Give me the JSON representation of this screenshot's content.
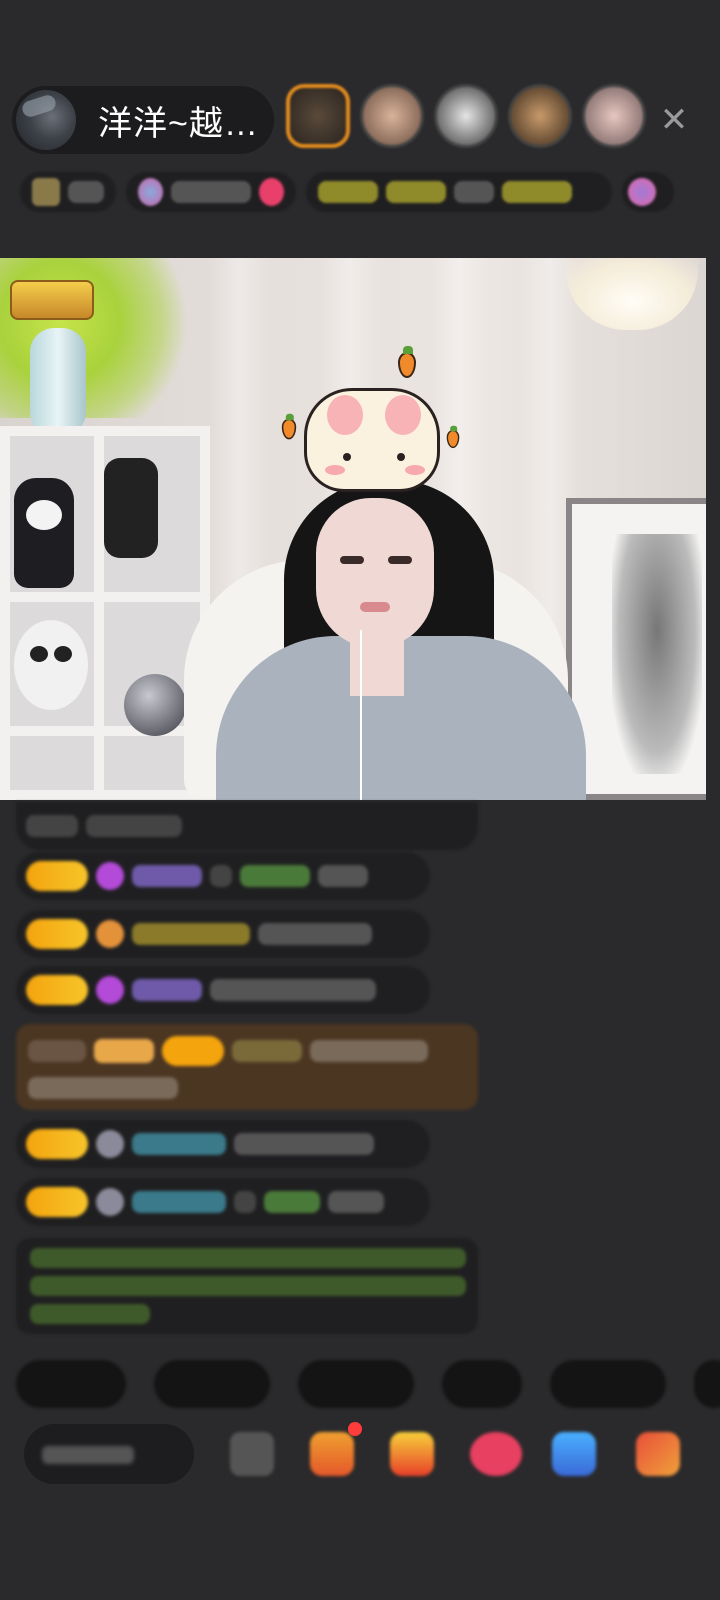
{
  "header": {
    "host_name": "洋洋~越…",
    "close_icon": "close-icon",
    "viewer_count": 5
  },
  "stream": {
    "logo_badge_text": "",
    "sticker": "bunny-sticker"
  },
  "colors": {
    "background": "#2a2a2c",
    "pill_dark": "#1c1c1e",
    "level_badge": "#f4a40d",
    "banner": "#4b3622",
    "close_icon": "#9a9a9a",
    "red_dot": "#ff3c3c"
  },
  "icons": [
    "close-icon",
    "emoji-icon",
    "gift-box-icon",
    "fries-icon",
    "heart-icon",
    "game-icon",
    "grid-icon"
  ]
}
